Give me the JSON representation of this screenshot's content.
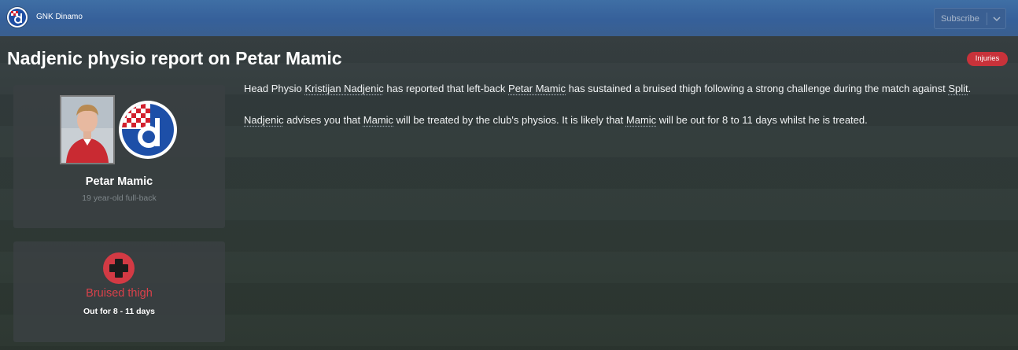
{
  "header": {
    "club_name": "GNK Dinamo",
    "subscribe_label": "Subscribe",
    "club_logo_icon": "dinamo-crest-icon",
    "dropdown_icon": "chevron-down-icon"
  },
  "news": {
    "title": "Nadjenic physio report on Petar Mamic",
    "category_badge": "Injuries",
    "category_color": "#c8323a"
  },
  "player_card": {
    "name": "Petar Mamic",
    "description": "19 year-old full-back",
    "photo_icon": "player-photo",
    "crest_icon": "dinamo-crest-icon"
  },
  "injury_card": {
    "icon": "injury-cross-icon",
    "injury": "Bruised thigh",
    "duration": "Out for 8 - 11 days",
    "injury_color": "#d9414a"
  },
  "body": {
    "p1": {
      "t1": "Head Physio ",
      "l1": "Kristijan Nadjenic",
      "t2": " has reported that left-back ",
      "l2": "Petar Mamic",
      "t3": " has sustained a bruised thigh following a strong challenge during the match against ",
      "l3": "Split",
      "t4": "."
    },
    "p2": {
      "l1": "Nadjenic",
      "t1": " advises you that ",
      "l2": "Mamic",
      "t2": " will be treated by the club's physios. It is likely that ",
      "l3": "Mamic",
      "t3": " will be out for 8 to 11 days whilst he is treated."
    }
  }
}
